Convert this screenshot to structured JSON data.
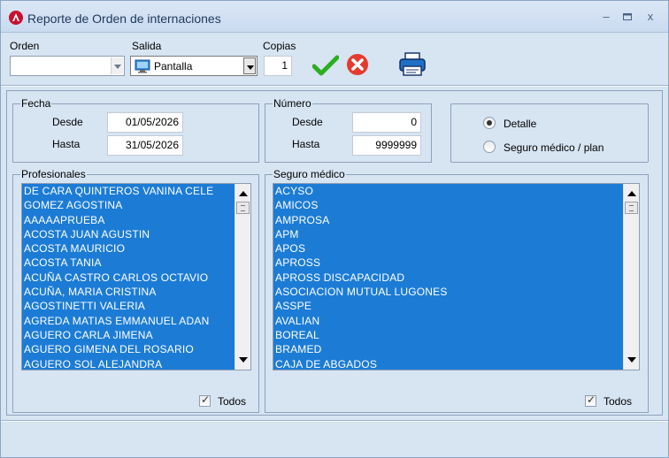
{
  "window": {
    "title": "Reporte de Orden de internaciones"
  },
  "toolbar": {
    "orden_label": "Orden",
    "orden_value": "",
    "salida_label": "Salida",
    "salida_value": "Pantalla",
    "copias_label": "Copias",
    "copias_value": "1"
  },
  "fecha": {
    "legend": "Fecha",
    "desde_label": "Desde",
    "desde_value": "01/05/2026",
    "hasta_label": "Hasta",
    "hasta_value": "31/05/2026"
  },
  "numero": {
    "legend": "Número",
    "desde_label": "Desde",
    "desde_value": "0",
    "hasta_label": "Hasta",
    "hasta_value": "9999999"
  },
  "modo": {
    "detalle_label": "Detalle",
    "seguro_label": "Seguro médico / plan",
    "selected": "Detalle"
  },
  "profesionales": {
    "legend": "Profesionales",
    "todos_label": "Todos",
    "items": [
      " DE CARA QUINTEROS VANINA CELE",
      " GOMEZ AGOSTINA",
      "AAAAAPRUEBA",
      "ACOSTA JUAN AGUSTIN",
      "ACOSTA MAURICIO",
      "ACOSTA TANIA",
      "ACUÑA CASTRO CARLOS OCTAVIO",
      "ACUÑA, MARIA CRISTINA",
      "AGOSTINETTI VALERIA",
      "AGREDA MATIAS EMMANUEL ADAN",
      "AGUERO CARLA JIMENA",
      "AGUERO GIMENA DEL ROSARIO",
      "AGUERO SOL ALEJANDRA"
    ]
  },
  "seguro": {
    "legend": "Seguro médico",
    "todos_label": "Todos",
    "items": [
      "ACYSO",
      "AMICOS",
      "AMPROSA",
      "APM",
      "APOS",
      "APROSS",
      "APROSS DISCAPACIDAD",
      "ASOCIACION MUTUAL LUGONES",
      "ASSPE",
      "AVALIAN",
      "BOREAL",
      "BRAMED",
      "CAJA DE ABGADOS"
    ]
  },
  "colors": {
    "selection": "#1c7cd5",
    "background": "#d7e4f2",
    "accept": "#2cae1f",
    "cancel": "#e53b2e"
  }
}
